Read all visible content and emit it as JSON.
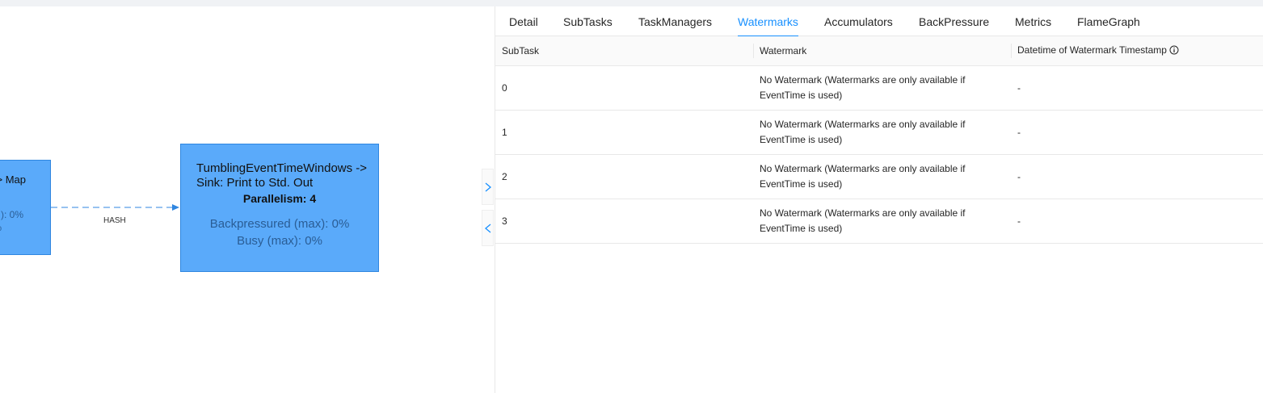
{
  "graph": {
    "left_node": {
      "line1": "> Map",
      "line2": "): 0%",
      "line3": "%"
    },
    "main_node": {
      "title": "TumblingEventTimeWindows -> Sink: Print to Std. Out",
      "parallelism": "Parallelism: 4",
      "backpressured": "Backpressured (max): 0%",
      "busy": "Busy (max): 0%"
    },
    "edge_label": "HASH",
    "colors": {
      "node_fill": "#5aaafa",
      "edge": "#2f86e0"
    }
  },
  "tabs": [
    {
      "label": "Detail"
    },
    {
      "label": "SubTasks"
    },
    {
      "label": "TaskManagers"
    },
    {
      "label": "Watermarks",
      "active": true
    },
    {
      "label": "Accumulators"
    },
    {
      "label": "BackPressure"
    },
    {
      "label": "Metrics"
    },
    {
      "label": "FlameGraph"
    }
  ],
  "table": {
    "columns": [
      "SubTask",
      "Watermark",
      "Datetime of Watermark Timestamp"
    ],
    "info_icon": "info-icon",
    "rows": [
      {
        "subtask": "0",
        "watermark": "No Watermark (Watermarks are only available if EventTime is used)",
        "datetime": "-"
      },
      {
        "subtask": "1",
        "watermark": "No Watermark (Watermarks are only available if EventTime is used)",
        "datetime": "-"
      },
      {
        "subtask": "2",
        "watermark": "No Watermark (Watermarks are only available if EventTime is used)",
        "datetime": "-"
      },
      {
        "subtask": "3",
        "watermark": "No Watermark (Watermarks are only available if EventTime is used)",
        "datetime": "-"
      }
    ]
  },
  "accent_color": "#1890ff"
}
